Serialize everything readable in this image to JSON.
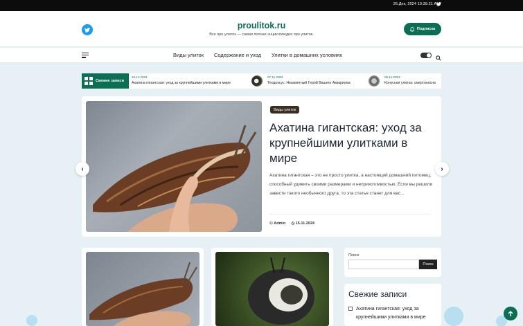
{
  "topbar": {
    "datetime": "26.Дек, 2024 10:39:21 AM",
    "social_icon": "twitter-icon"
  },
  "header": {
    "brand": "proulitok.ru",
    "tagline": "Все про улиток — самая полная энциклопедия про улиток.",
    "subscribe_label": "Подписка"
  },
  "nav": {
    "items": [
      "Виды улиток",
      "Содержание и уход",
      "Улитки в домашних условиях"
    ]
  },
  "ticker": {
    "label": "Свежие записи",
    "items": [
      {
        "date": "15.11.2024",
        "title": "Ахатина гигантская: уход за крупнейшими улитками в мире"
      },
      {
        "date": "07.11.2024",
        "title": "Теодоксус: Незаметный Герой Вашего Аквариума"
      },
      {
        "date": "06.11.2024",
        "title": "Конусная улитка: смертоносна"
      }
    ]
  },
  "hero": {
    "category": "Виды улиток",
    "title": "Ахатина гигантская: уход за крупнейшими улитками в мире",
    "excerpt": "Ахатина гигантская – это не просто улитка, а настоящий домашний питомец, способный удивить своими размерами и неприхотливостью. Если вы решили завести такого необычного друга, то эта статья станет для вас...",
    "author": "Admin",
    "date": "15.11.2024"
  },
  "sidebar": {
    "search_label": "Поиск",
    "search_button": "Поиск",
    "recent_title": "Свежие записи",
    "recent_item": "Ахатина гигантская: уход за крупнейшими улитками в мире"
  },
  "colors": {
    "accent": "#0d6e56",
    "dark": "#0c0c0c",
    "background": "#e6f0f5"
  }
}
